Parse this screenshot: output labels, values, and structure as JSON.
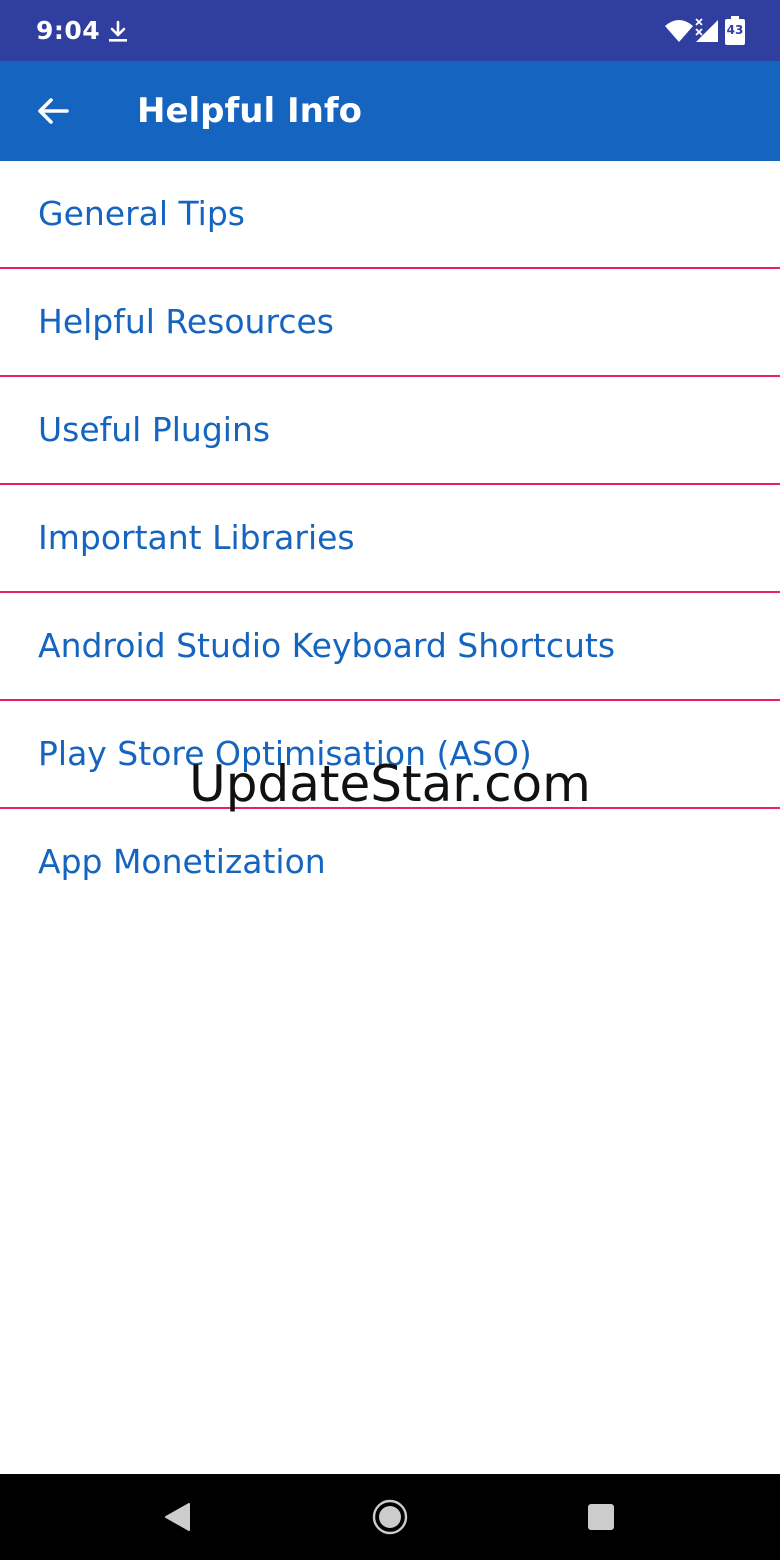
{
  "status_bar": {
    "time": "9:04",
    "battery_level": "43",
    "icons": [
      "download-icon",
      "wifi-icon",
      "signal-icon",
      "battery-icon"
    ]
  },
  "app_bar": {
    "title": "Helpful Info",
    "back_icon": "arrow-back-icon"
  },
  "menu": {
    "items": [
      {
        "label": "General Tips"
      },
      {
        "label": "Helpful Resources"
      },
      {
        "label": "Useful Plugins"
      },
      {
        "label": "Important Libraries"
      },
      {
        "label": "Android Studio Keyboard Shortcuts"
      },
      {
        "label": "Play Store Optimisation (ASO)"
      },
      {
        "label": "App Monetization"
      }
    ]
  },
  "watermark": "UpdateStar.com",
  "nav_bar": {
    "icons": [
      "nav-back-icon",
      "nav-home-icon",
      "nav-recents-icon"
    ]
  },
  "colors": {
    "status_bar": "#303f9f",
    "app_bar": "#1565c0",
    "item_text": "#1565c0",
    "divider": "#e91e63",
    "nav_bar": "#000000"
  }
}
